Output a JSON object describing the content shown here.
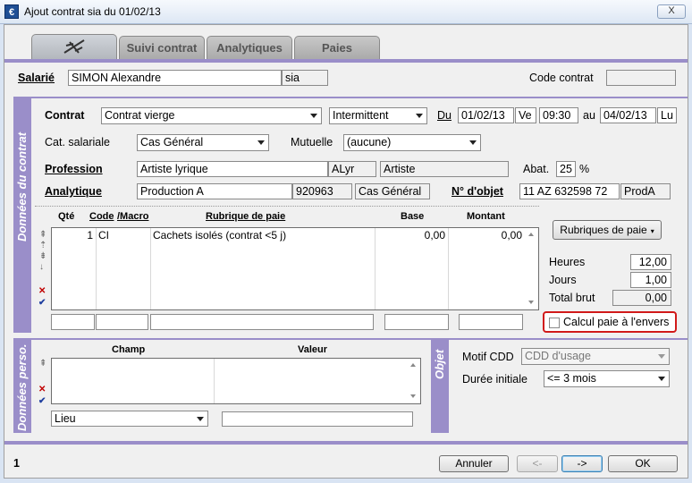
{
  "window": {
    "title": "Ajout contrat sia du 01/02/13",
    "icon": "€",
    "close": "X"
  },
  "tabs": [
    {
      "label": ""
    },
    {
      "label": "Suivi contrat"
    },
    {
      "label": "Analytiques"
    },
    {
      "label": "Paies"
    }
  ],
  "header": {
    "salarie_label": "Salarié",
    "salarie_value": "SIMON Alexandre",
    "salarie_code": "sia",
    "code_contrat_label": "Code contrat",
    "code_contrat_value": ""
  },
  "section_labels": {
    "donnees_contrat": "Données du contrat",
    "donnees_perso": "Données perso.",
    "objet": "Objet"
  },
  "contrat": {
    "label": "Contrat",
    "type_value": "Contrat vierge",
    "statut_value": "Intermittent",
    "du_label": "Du",
    "du_date": "01/02/13",
    "du_day": "Ve",
    "du_time": "09:30",
    "au_label": "au",
    "au_date": "04/02/13",
    "au_day": "Lu",
    "cat_label": "Cat. salariale",
    "cat_value": "Cas Général",
    "mutuelle_label": "Mutuelle",
    "mutuelle_value": "(aucune)",
    "profession_label": "Profession",
    "profession_value": "Artiste lyrique",
    "profession_code": "ALyr",
    "profession_type": "Artiste",
    "abat_label": "Abat.",
    "abat_value": "25",
    "abat_unit": "%",
    "analytique_label": "Analytique",
    "analytique_value": "Production A",
    "analytique_code": "920963",
    "analytique_cat": "Cas Général",
    "objet_label": "N° d'objet",
    "objet_value": "11 AZ 632598 72",
    "objet_code": "ProdA"
  },
  "paie_table": {
    "headers": {
      "qte": "Qté",
      "code": "Code",
      "macro": "/Macro",
      "rubrique": "Rubrique de paie",
      "base": "Base",
      "montant": "Montant"
    },
    "rows": [
      {
        "qte": "1",
        "code": "CI",
        "rubrique": "Cachets isolés (contrat <5 j)",
        "base": "0,00",
        "montant": "0,00"
      }
    ]
  },
  "side": {
    "rubriques_button": "Rubriques de paie",
    "heures_label": "Heures",
    "heures_value": "12,00",
    "jours_label": "Jours",
    "jours_value": "1,00",
    "total_label": "Total brut",
    "total_value": "0,00",
    "calcul_label": "Calcul paie à l'envers"
  },
  "perso": {
    "champ_header": "Champ",
    "valeur_header": "Valeur",
    "lieu_value": "Lieu",
    "lieu_input": ""
  },
  "objet": {
    "motif_label": "Motif CDD",
    "motif_value": "CDD d'usage",
    "duree_label": "Durée initiale",
    "duree_value": "<= 3 mois"
  },
  "footer": {
    "page": "1",
    "annuler": "Annuler",
    "prev": "<-",
    "next": "->",
    "ok": "OK"
  },
  "colors": {
    "accent": "#9a8ec9",
    "highlight": "#d11a1a"
  }
}
